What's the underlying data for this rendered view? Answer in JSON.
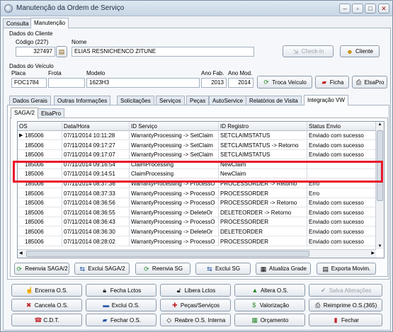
{
  "window": {
    "title": "Manutenção da Ordem de Serviço"
  },
  "top_tabs": [
    "Consulta",
    "Manutenção"
  ],
  "cliente": {
    "section_label": "Dados do Cliente",
    "codigo_label": "Código (227)",
    "codigo_value": "327497",
    "nome_label": "Nome",
    "nome_value": "ELIAS RESNICHENCO ZITUNE",
    "checkin_label": "Check-in",
    "cliente_label": "Cliente"
  },
  "veiculo": {
    "section_label": "Dados do Veículo",
    "placa_label": "Placa",
    "placa_value": "FOC1784",
    "frota_label": "Frota",
    "frota_value": "",
    "modelo_label": "Modelo",
    "modelo_value": "1623H3",
    "anofab_label": "Ano Fab.",
    "anofab_value": "2013",
    "anomod_label": "Ano Mod.",
    "anomod_value": "2014",
    "troca_label": "Troca Veículo",
    "ficha_label": "Ficha",
    "elsapro_label": "ElsaPro"
  },
  "main_tabs": [
    "Dados Gerais",
    "Outras Informações",
    "Solicitações",
    "Serviços",
    "Peças",
    "AutoService",
    "Relatórios de Visita",
    "Integração VW"
  ],
  "sub_tabs": [
    "SAGA/2",
    "ElsaPro"
  ],
  "grid": {
    "columns": [
      "OS",
      "Data/Hora",
      "ID Serviço",
      "ID Registro",
      "Status Envio"
    ],
    "rows": [
      [
        "185006",
        "07/11/2014 10:11:28",
        "WarrantyProcessing -> SetClaim",
        "SETCLAIMSTATUS",
        "Enviado com sucesso"
      ],
      [
        "185006",
        "07/11/2014 09:17:27",
        "WarrantyProcessing -> SetClaim",
        "SETCLAIMSTATUS -> Retorno",
        "Enviado com sucesso"
      ],
      [
        "185006",
        "07/11/2014 09:17:07",
        "WarrantyProcessing -> SetClaim",
        "SETCLAIMSTATUS",
        "Enviado com sucesso"
      ],
      [
        "185006",
        "07/11/2014 09:16:54",
        "ClaimProcessing",
        "NewClaim",
        ""
      ],
      [
        "185006",
        "07/11/2014 09:14:51",
        "ClaimProcessing",
        "NewClaim",
        ""
      ],
      [
        "185006",
        "07/11/2014 08:37:36",
        "WarrantyProcessing -> ProcessO",
        "PROCESSORDER -> Retorno",
        "Erro"
      ],
      [
        "185006",
        "07/11/2014 08:37:33",
        "WarrantyProcessing -> ProcessO",
        "PROCESSORDER",
        "Erro"
      ],
      [
        "185006",
        "07/11/2014 08:36:56",
        "WarrantyProcessing -> ProcessO",
        "PROCESSORDER -> Retorno",
        "Enviado com sucesso"
      ],
      [
        "185006",
        "07/11/2014 08:36:55",
        "WarrantyProcessing -> DeleteOr",
        "DELETEORDER -> Retorno",
        "Enviado com sucesso"
      ],
      [
        "185006",
        "07/11/2014 08:36:43",
        "WarrantyProcessing -> ProcessO",
        "PROCESSORDER",
        "Enviado com sucesso"
      ],
      [
        "185006",
        "07/11/2014 08:36:30",
        "WarrantyProcessing -> DeleteOr",
        "DELETEORDER",
        "Enviado com sucesso"
      ],
      [
        "185006",
        "07/11/2014 08:28:02",
        "WarrantyProcessing -> ProcessO",
        "PROCESSORDER",
        "Enviado com sucesso"
      ]
    ]
  },
  "grid_buttons": [
    "Reenvia SAGA/2",
    "Exclui SAGA/2",
    "Reenvia SG",
    "Exclui SG",
    "Atualiza Grade",
    "Exporta Movim."
  ],
  "bottom_buttons": [
    [
      "Encerra O.S.",
      "Fecha Lctos",
      "Libera Lctos",
      "Altera O.S.",
      "Salva Alterações"
    ],
    [
      "Cancela O.S.",
      "Exclui O.S.",
      "Peças/Serviços",
      "Valorização",
      "Reimprime O.S.(365)"
    ],
    [
      "C.D.T.",
      "Fechar O.S.",
      "Reabre O.S. Interna",
      "Orçamento",
      "Fechar"
    ]
  ],
  "colors": {
    "highlight": "#e8162c",
    "accent_green": "#2a8a2a",
    "accent_red": "#c0262b",
    "accent_blue": "#2b5aa8"
  }
}
